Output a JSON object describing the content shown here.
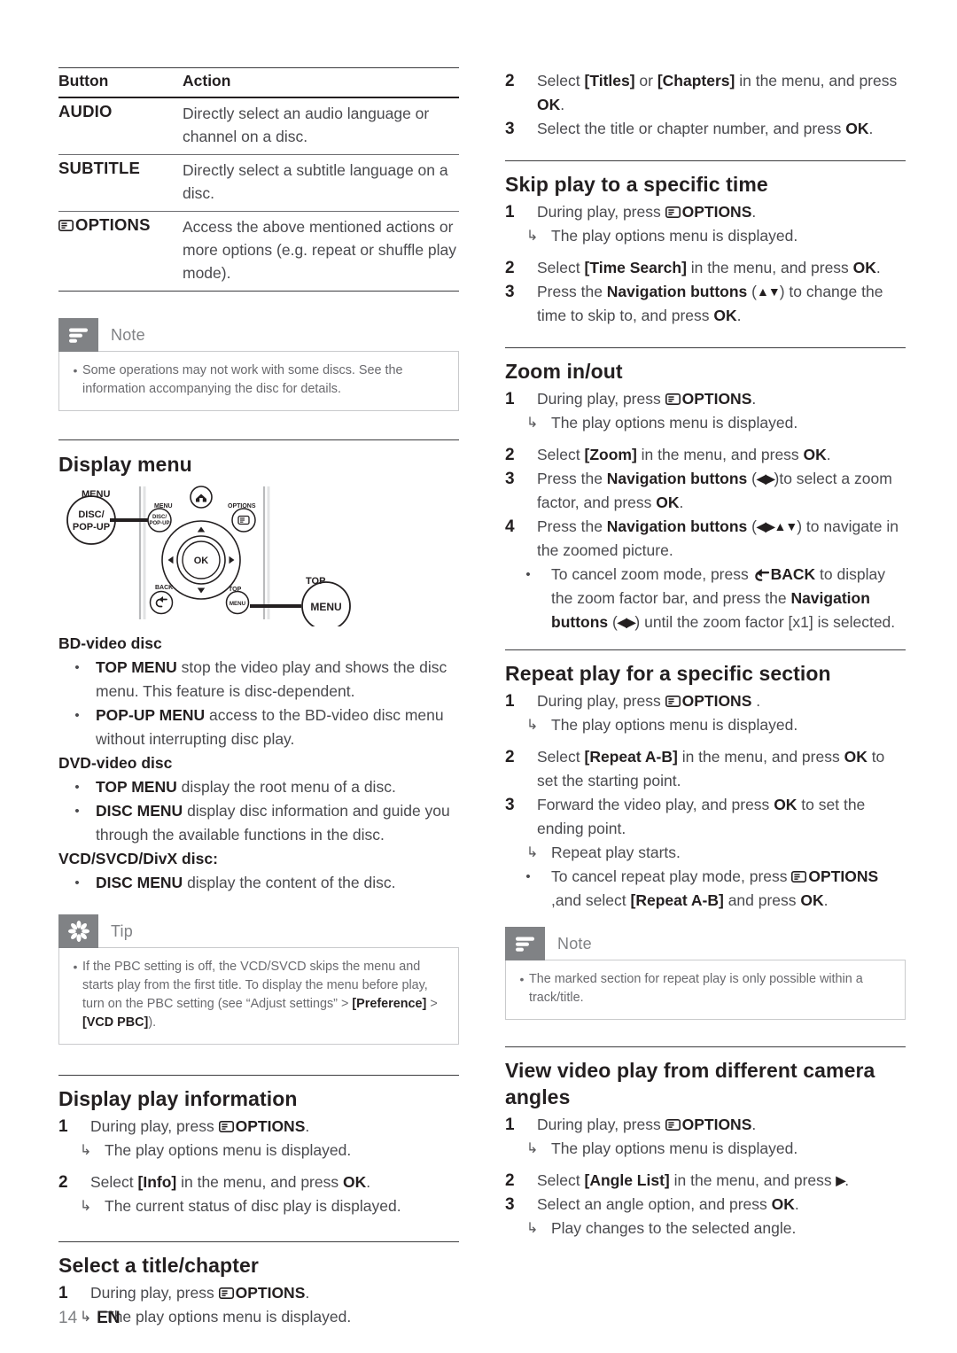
{
  "page": {
    "number": "14",
    "language": "EN"
  },
  "left": {
    "table": {
      "headers": [
        "Button",
        "Action"
      ],
      "rows": [
        {
          "button": "AUDIO",
          "icon": null,
          "action": "Directly select an audio language or channel on a disc."
        },
        {
          "button": "SUBTITLE",
          "icon": null,
          "action": "Directly select a subtitle language on a disc."
        },
        {
          "button": "OPTIONS",
          "icon": "options-icon",
          "action": "Access the above mentioned actions or more options (e.g. repeat or shuffle play mode)."
        }
      ]
    },
    "note": {
      "title": "Note",
      "icon": "note-lines-icon",
      "items": [
        "Some operations may not work with some discs. See the information accompanying the disc for details."
      ]
    },
    "display_menu": {
      "heading": "Display menu",
      "remote": {
        "callout_left_label": "MENU",
        "callout_left_button": "DISC/\nPOP-UP",
        "callout_right_label": "TOP",
        "callout_right_button": "MENU",
        "inner_labels": [
          "MENU",
          "OPTIONS",
          "BACK",
          "TOP"
        ],
        "inner_buttons": [
          "DISC/ POP-UP",
          "OK",
          "MENU"
        ],
        "home_icon": "home-icon",
        "options_icon": "options-icon",
        "back_icon": "back-arrow-icon"
      },
      "groups": [
        {
          "title": "BD-video disc",
          "items": [
            {
              "term": "TOP MENU",
              "rest": " stop the video play and shows the disc menu. This feature is disc-dependent."
            },
            {
              "term": "POP-UP MENU",
              "rest": " access to the BD-video disc menu without interrupting disc play."
            }
          ]
        },
        {
          "title": "DVD-video disc",
          "items": [
            {
              "term": "TOP MENU",
              "rest": " display the root menu of a disc."
            },
            {
              "term": "DISC MENU",
              "rest": " display disc information and guide you through the available functions in the disc."
            }
          ]
        },
        {
          "title": "VCD/SVCD/DivX disc:",
          "items": [
            {
              "term": "DISC MENU",
              "rest": " display the content of the disc."
            }
          ]
        }
      ]
    },
    "tip": {
      "title": "Tip",
      "icon": "asterisk-icon",
      "text_1": "If the PBC setting is off, the VCD/SVCD skips the menu and starts play from the first title. To display the menu before play, turn on the PBC setting (see “Adjust settings” > ",
      "text_bold_1": "[Preference]",
      "text_2": " > ",
      "text_bold_2": "[VCD PBC]",
      "text_3": ")."
    },
    "display_play_info": {
      "heading": "Display play information",
      "step1_num": "1",
      "step1_a": "During play, press ",
      "step1_b": "OPTIONS",
      "step1_c": ".",
      "step1_sub": "The play options menu is displayed.",
      "step2_num": "2",
      "step2_a": "Select ",
      "step2_b": "[Info]",
      "step2_c": " in the menu, and press ",
      "step2_d": "OK",
      "step2_e": ".",
      "step2_sub": "The current status of disc play is displayed."
    },
    "select_title_chapter": {
      "heading": "Select a title/chapter",
      "step1_num": "1",
      "step1_a": "During play, press ",
      "step1_b": "OPTIONS",
      "step1_c": ".",
      "step1_sub": "The play options menu is displayed."
    }
  },
  "right": {
    "select_title_cont": {
      "step2_num": "2",
      "step2_a": "Select ",
      "step2_b": "[Titles]",
      "step2_c": " or ",
      "step2_d": "[Chapters]",
      "step2_e": " in the menu, and press ",
      "step2_f": "OK",
      "step2_g": ".",
      "step3_num": "3",
      "step3_a": "Select the title or chapter number, and press ",
      "step3_b": "OK",
      "step3_c": "."
    },
    "skip_play": {
      "heading": "Skip play to a specific time",
      "step1_num": "1",
      "step1_a": "During play, press ",
      "step1_b": "OPTIONS",
      "step1_c": ".",
      "step1_sub": "The play options menu is displayed.",
      "step2_num": "2",
      "step2_a": "Select ",
      "step2_b": "[Time Search]",
      "step2_c": " in the menu, and press ",
      "step2_d": "OK",
      "step2_e": ".",
      "step3_num": "3",
      "step3_a": "Press the ",
      "step3_b": "Navigation buttons",
      "step3_c": " (",
      "step3_nav": "▲▼",
      "step3_d": ") to change the time to skip to, and press ",
      "step3_e": "OK",
      "step3_f": "."
    },
    "zoom": {
      "heading": "Zoom in/out",
      "step1_num": "1",
      "step1_a": "During play, press ",
      "step1_b": "OPTIONS",
      "step1_c": ".",
      "step1_sub": "The play options menu is displayed.",
      "step2_num": "2",
      "step2_a": "Select ",
      "step2_b": "[Zoom]",
      "step2_c": " in the menu, and press ",
      "step2_d": "OK",
      "step2_e": ".",
      "step3_num": "3",
      "step3_a": "Press the ",
      "step3_b": "Navigation buttons",
      "step3_c": " (",
      "step3_nav": "◀▶",
      "step3_d": ")to select a zoom factor, and press ",
      "step3_e": "OK",
      "step3_f": ".",
      "step4_num": "4",
      "step4_a": "Press the ",
      "step4_b": "Navigation buttons",
      "step4_c": " (",
      "step4_nav": "◀▶▲▼",
      "step4_d": ") to navigate in the zoomed picture.",
      "bullet_a": "To cancel zoom mode, press ",
      "bullet_b": "BACK",
      "bullet_c": " to display the zoom factor bar, and press the ",
      "bullet_d": "Navigation buttons",
      "bullet_e": " (",
      "bullet_nav": "◀▶",
      "bullet_f": ") until the zoom factor [x1] is selected."
    },
    "repeat": {
      "heading": "Repeat play for a specific section",
      "step1_num": "1",
      "step1_a": "During play, press ",
      "step1_b": "OPTIONS",
      "step1_c": " .",
      "step1_sub": "The play options menu is displayed.",
      "step2_num": "2",
      "step2_a": "Select ",
      "step2_b": "[Repeat A-B]",
      "step2_c": " in the menu, and press ",
      "step2_d": "OK",
      "step2_e": " to set the starting point.",
      "step3_num": "3",
      "step3_a": "Forward the video play, and press ",
      "step3_b": "OK",
      "step3_c": " to set the ending point.",
      "step3_sub": "Repeat play starts.",
      "bullet_a": "To cancel repeat play mode, press ",
      "bullet_b": "OPTIONS",
      "bullet_c": " ,and select ",
      "bullet_d": "[Repeat A-B]",
      "bullet_e": " and press ",
      "bullet_f": "OK",
      "bullet_g": "."
    },
    "note": {
      "title": "Note",
      "icon": "note-lines-icon",
      "items": [
        "The marked section for repeat play is only possible within a track/title."
      ]
    },
    "camera_angles": {
      "heading": "View video play from different camera angles",
      "step1_num": "1",
      "step1_a": "During play, press ",
      "step1_b": "OPTIONS",
      "step1_c": ".",
      "step1_sub": "The play options menu is displayed.",
      "step2_num": "2",
      "step2_a": "Select ",
      "step2_b": "[Angle List]",
      "step2_c": " in the menu, and press ",
      "step2_nav": "▶",
      "step2_d": ".",
      "step3_num": "3",
      "step3_a": "Select an angle option, and press ",
      "step3_b": "OK",
      "step3_c": ".",
      "step3_sub": "Play changes to the selected angle."
    }
  },
  "glyphs": {
    "arrow_sub": "↳",
    "bullet": "•"
  }
}
